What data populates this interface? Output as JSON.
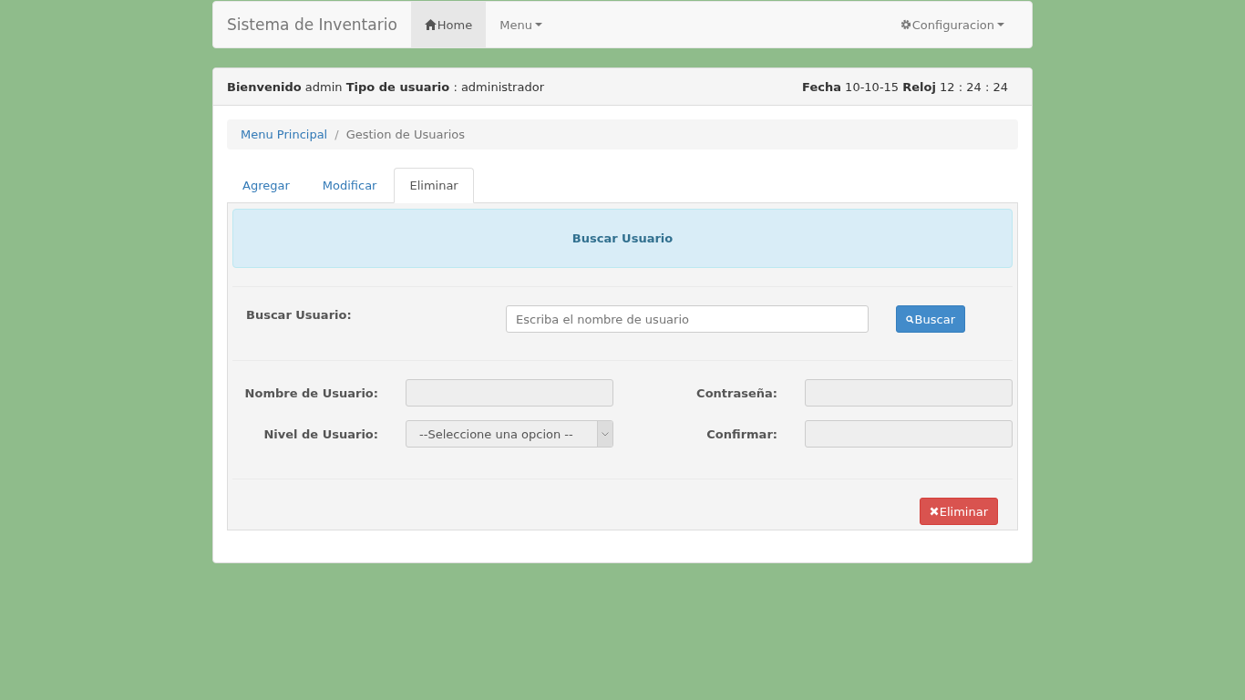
{
  "navbar": {
    "brand": "Sistema de Inventario",
    "items": [
      {
        "label": "Home",
        "kind": "home",
        "dropdown": false,
        "selected": true
      },
      {
        "label": "Menu",
        "kind": "plain",
        "dropdown": true,
        "selected": false
      }
    ],
    "right_items": [
      {
        "label": "Configuracion",
        "kind": "gear",
        "dropdown": true,
        "selected": false
      }
    ]
  },
  "panel_header": {
    "welcome": "**Bienvenido** admin **Tipo de usuario** : administrador",
    "clock": "**Fecha** 10-10-15 **Reloj** 12 : 24 : 24"
  },
  "breadcrumb": {
    "separator": "/",
    "items": [
      {
        "label": "Menu Principal",
        "kind": "link"
      },
      {
        "label": "Gestion de Usuarios",
        "kind": "current"
      }
    ]
  },
  "tabs": [
    {
      "label": "Agregar",
      "selected": false
    },
    {
      "label": "Modificar",
      "selected": false
    },
    {
      "label": "Eliminar",
      "selected": true
    }
  ],
  "alert": {
    "title": "Buscar Usuario"
  },
  "search": {
    "label": "Buscar Usuario:",
    "placeholder": "Escriba el nombre de usuario",
    "button": "Buscar"
  },
  "fields": [
    {
      "label": "Nombre de Usuario:",
      "kind": "text",
      "disabled": true
    },
    {
      "label": "Contraseña:",
      "kind": "text",
      "disabled": true
    },
    {
      "label": "Nivel de Usuario:",
      "kind": "select",
      "value": "--Seleccione una opcion --",
      "disabled": true
    },
    {
      "label": "Confirmar:",
      "kind": "text",
      "disabled": true
    }
  ],
  "delete_button": "Eliminar"
}
